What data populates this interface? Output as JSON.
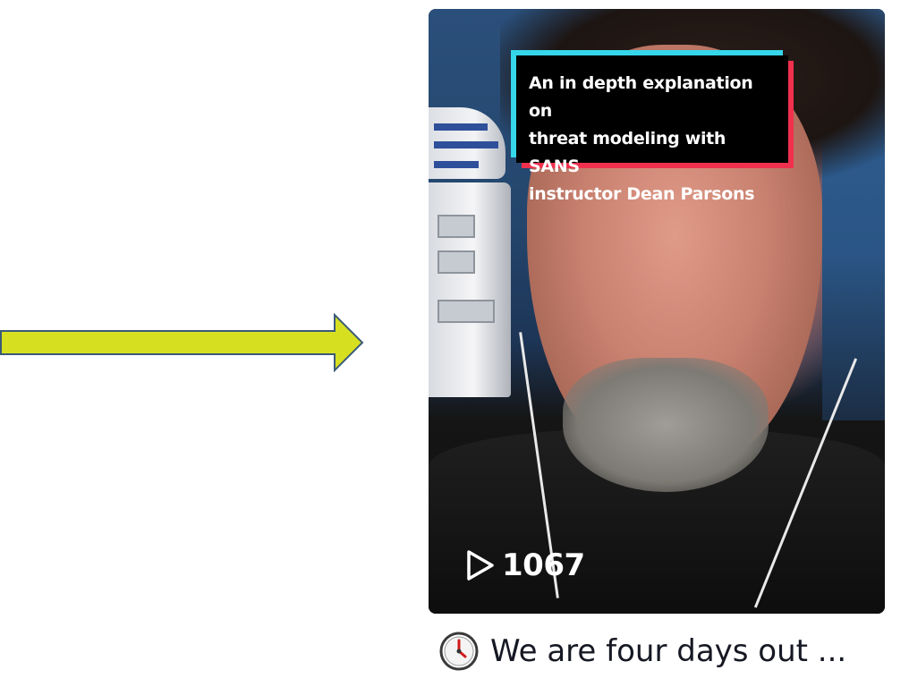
{
  "arrow": {
    "fill_color": "#d6e021",
    "stroke_color": "#3a5a78",
    "icon": "right-arrow-icon"
  },
  "video": {
    "caption_lines": [
      "An in depth explanation on",
      "threat modeling with SANS",
      "instructor Dean Parsons"
    ],
    "view_count": "1067",
    "play_icon": "play-outline-icon",
    "title": "We are four days out ...",
    "title_icon": "stopwatch-icon",
    "caption_colors": {
      "cyan": "#35d6ea",
      "red": "#f1304e",
      "background": "#000000"
    }
  }
}
